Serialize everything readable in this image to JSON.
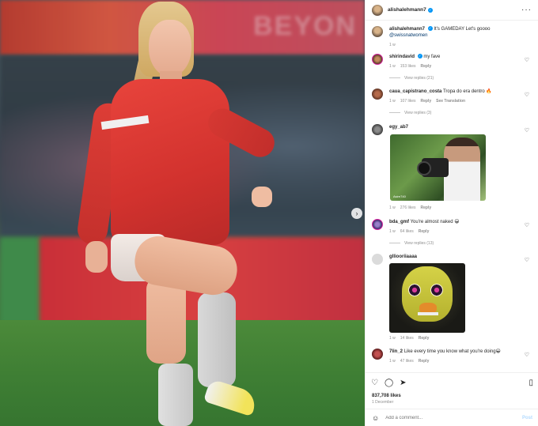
{
  "post": {
    "username": "alishalehmann7",
    "verified": true,
    "caption_user": "alishalehmann7",
    "caption_text": "It's GAMEDAY⁠⁠⁠ Let's goooo",
    "caption_mention": "@swissnatwomen",
    "caption_time": "1 w",
    "likes": "837,708 likes",
    "date": "1 December"
  },
  "photo": {
    "banner_text": "BEYON"
  },
  "comments": [
    {
      "user": "shirindavid",
      "verified": true,
      "text": "my fave",
      "time": "1 w",
      "likes": "153 likes",
      "reply": "Reply",
      "views": "View replies (21)"
    },
    {
      "user": "caua_capistrano_costa",
      "text": "Tropa do era dentro 🔥",
      "time": "1 w",
      "likes": "107 likes",
      "reply": "Reply",
      "translate": "See Translation",
      "views": "View replies (3)"
    },
    {
      "user": "egy_ab7",
      "text": "",
      "time": "1 w",
      "likes": "276 likes",
      "reply": "Reply",
      "image_watermark": "Asire740"
    },
    {
      "user": "bda_gmf",
      "text": "You're almost naked 😀",
      "time": "1 w",
      "likes": "64 likes",
      "reply": "Reply",
      "views": "View replies (13)"
    },
    {
      "user": "glliooriiaaaa",
      "text": "",
      "time": "1 w",
      "likes": "14 likes",
      "reply": "Reply"
    },
    {
      "user": "7lin_2",
      "text": "Like every time you know what you're doing😀",
      "time": "1 w",
      "likes": "47 likes",
      "reply": "Reply"
    }
  ],
  "add_comment": {
    "placeholder": "Add a comment...",
    "post_label": "Post"
  },
  "icons": {
    "more": "more-options-icon",
    "heart": "heart-icon",
    "comment": "comment-icon",
    "share": "share-icon",
    "bookmark": "bookmark-icon",
    "emoji": "emoji-icon",
    "next": "chevron-right-icon"
  },
  "colors": {
    "accent": "#0095f6",
    "post_disabled": "#b3dbff",
    "mention": "#00376b"
  }
}
